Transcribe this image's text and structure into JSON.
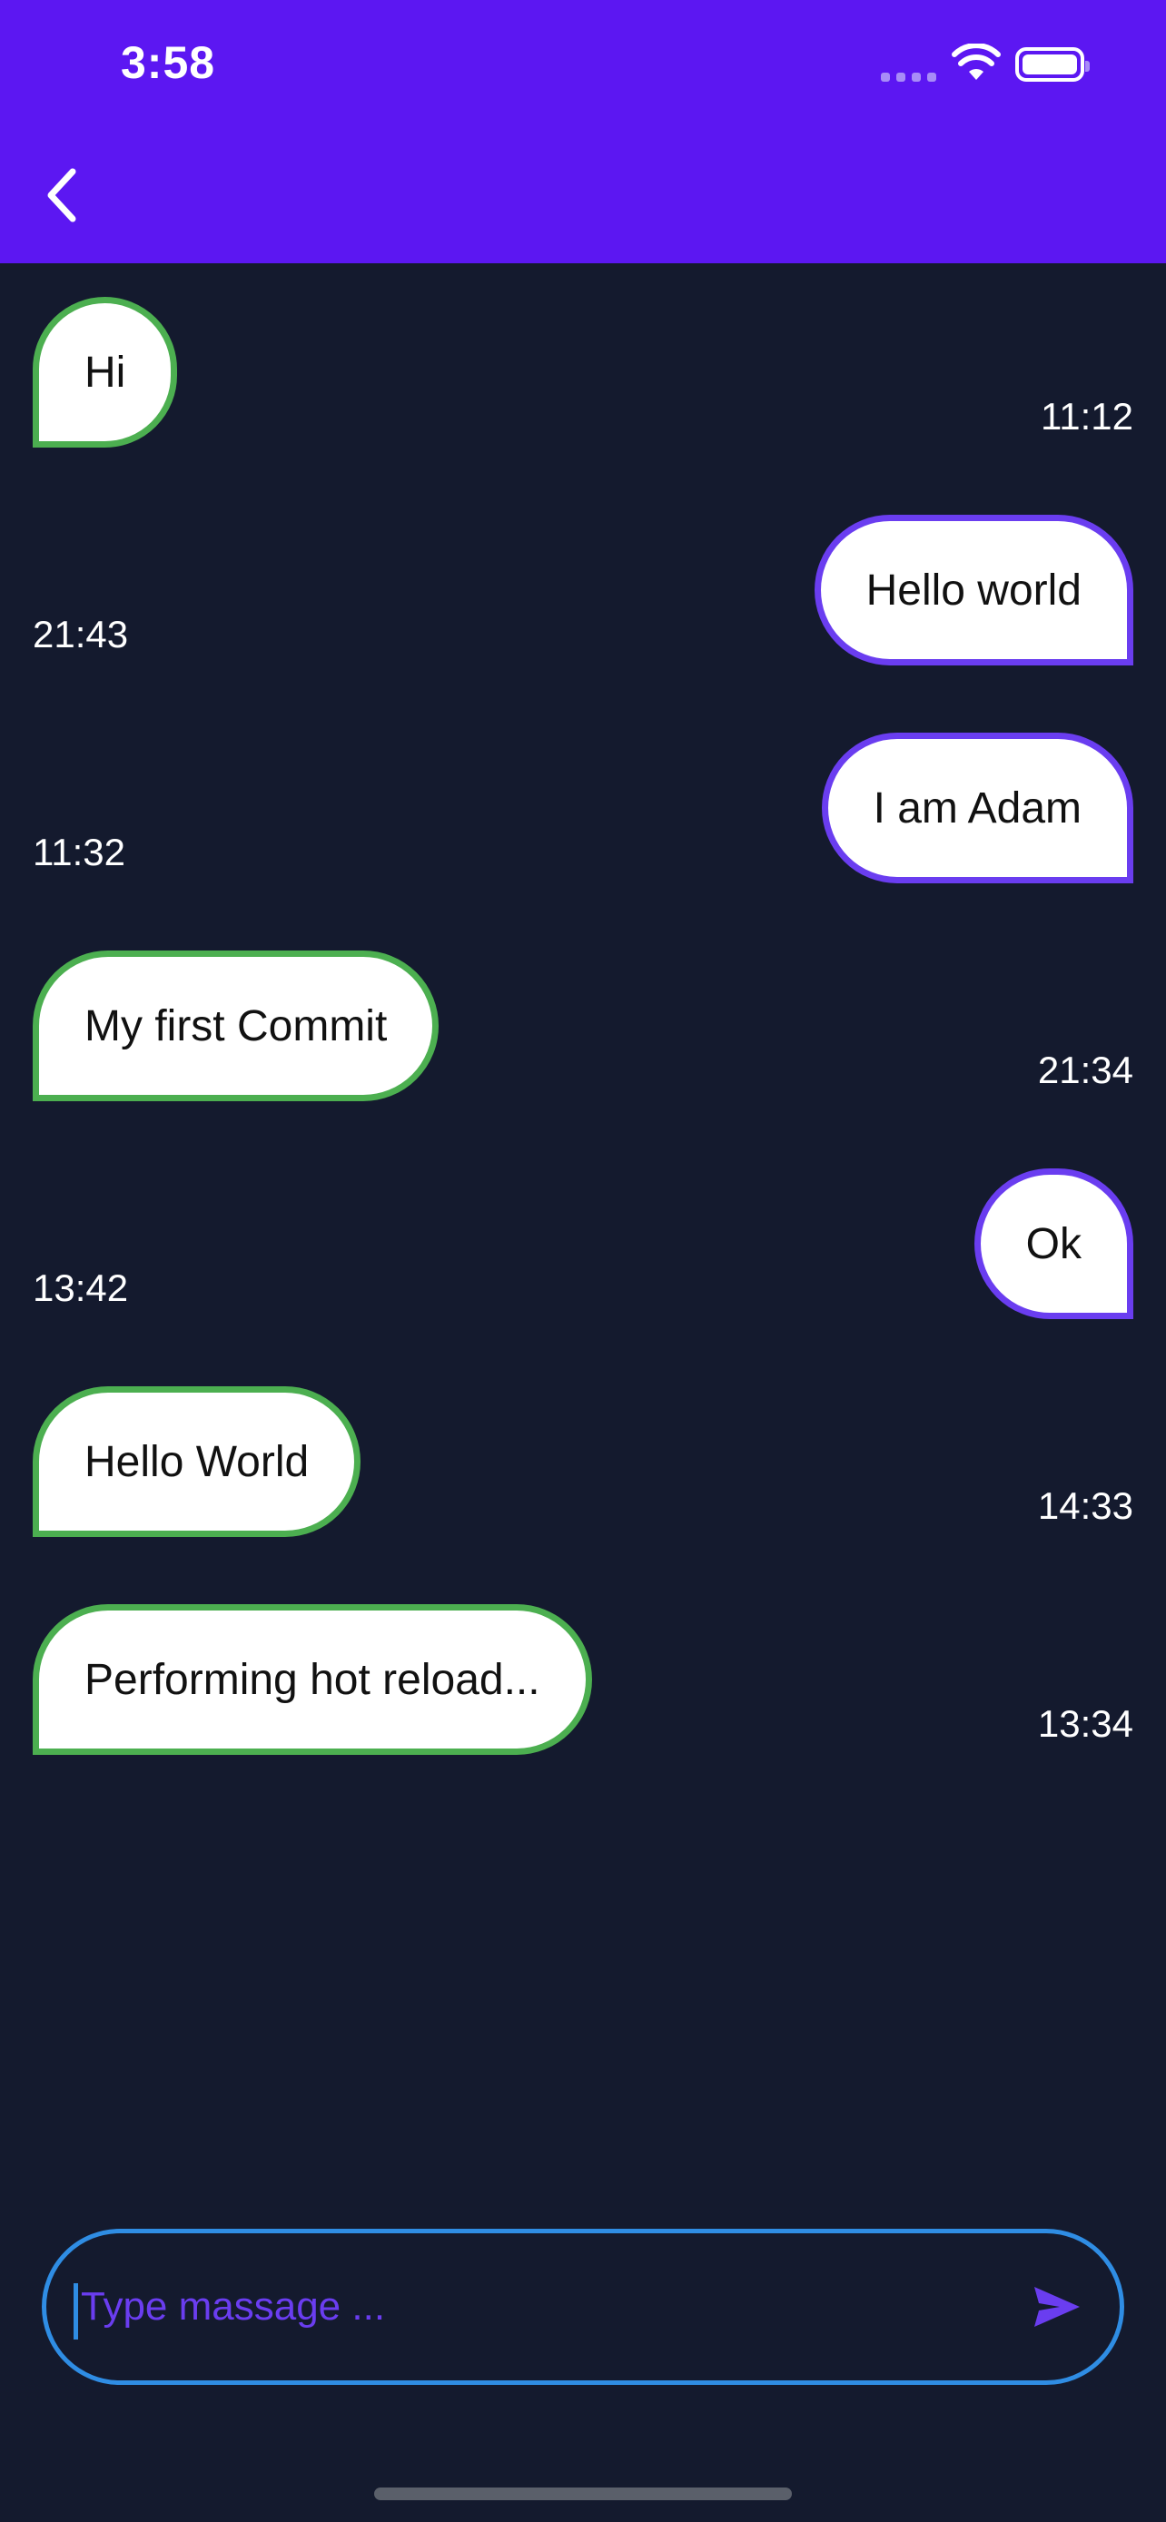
{
  "status_bar": {
    "time": "3:58"
  },
  "header": {
    "back_icon": "chevron-left-icon"
  },
  "messages": [
    {
      "text": "Hi",
      "time": "11:12",
      "side": "in"
    },
    {
      "text": "Hello world",
      "time": "21:43",
      "side": "out"
    },
    {
      "text": "I am Adam",
      "time": "11:32",
      "side": "out"
    },
    {
      "text": "My first Commit",
      "time": "21:34",
      "side": "in"
    },
    {
      "text": "Ok",
      "time": "13:42",
      "side": "out"
    },
    {
      "text": "Hello World",
      "time": "14:33",
      "side": "in"
    },
    {
      "text": "Performing hot reload...",
      "time": "13:34",
      "side": "in"
    }
  ],
  "composer": {
    "placeholder": "Type massage ...",
    "value": "",
    "send_icon": "send-icon"
  },
  "colors": {
    "header": "#5c17f2",
    "background": "#141a2e",
    "incoming_border": "#4caf50",
    "outgoing_border": "#6a3df0",
    "input_border": "#2f8de4"
  }
}
